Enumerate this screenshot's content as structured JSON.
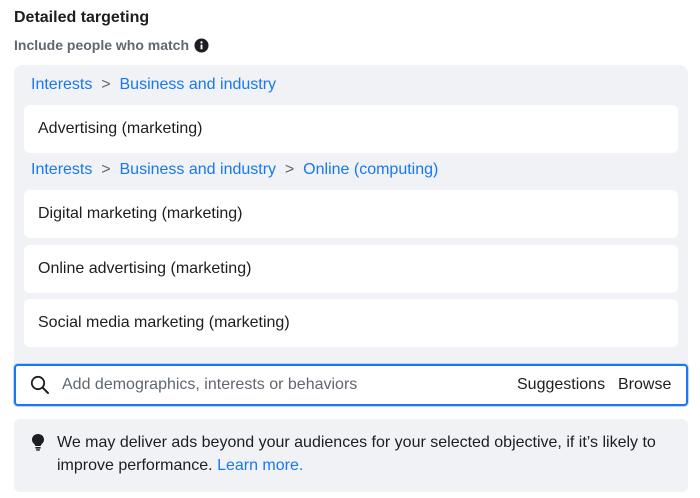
{
  "header": {
    "title": "Detailed targeting",
    "subtitle": "Include people who match",
    "info_icon": "info-icon"
  },
  "groups": [
    {
      "path": [
        "Interests",
        "Business and industry"
      ],
      "separator": ">",
      "items": [
        "Advertising (marketing)"
      ]
    },
    {
      "path": [
        "Interests",
        "Business and industry",
        "Online (computing)"
      ],
      "separator": ">",
      "items": [
        "Digital marketing (marketing)",
        "Online advertising (marketing)",
        "Social media marketing (marketing)"
      ]
    }
  ],
  "search": {
    "placeholder": "Add demographics, interests or behaviors",
    "value": "",
    "suggestions_label": "Suggestions",
    "browse_label": "Browse",
    "icon": "search-icon"
  },
  "notice": {
    "icon": "lightbulb-icon",
    "text": "We may deliver ads beyond your audiences for your selected objective, if it’s likely to improve performance.",
    "link_text": "Learn more."
  },
  "colors": {
    "link": "#1877f2",
    "panel_bg": "#f0f2f5",
    "focus_border": "#1877f2",
    "muted_text": "#606770"
  }
}
